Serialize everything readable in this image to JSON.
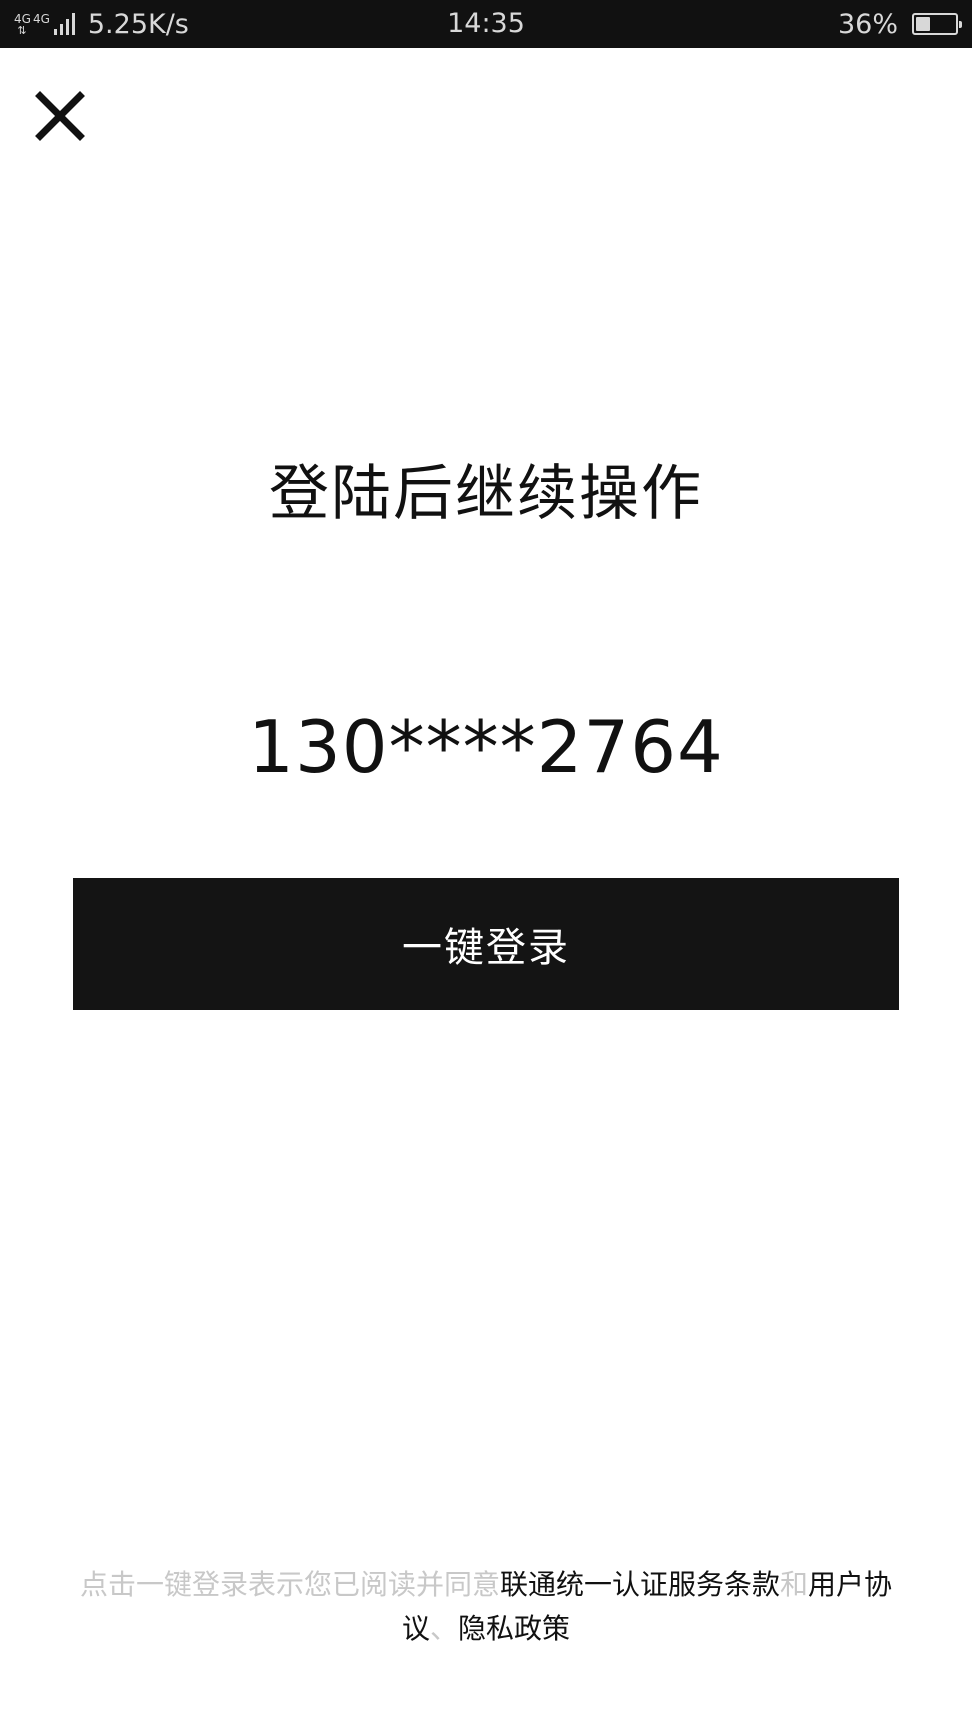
{
  "status_bar": {
    "network_type": "4G",
    "network_type_2": "4G",
    "net_speed": "5.25K/s",
    "time": "14:35",
    "battery_percent": "36%",
    "battery_level": 0.36
  },
  "close_icon": "close-icon",
  "title": "登陆后继续操作",
  "phone_number": "130****2764",
  "login_button_label": "一键登录",
  "agreement": {
    "prefix": "点击一键登录表示您已阅读并同意",
    "terms_link": "联通统一认证服务条款",
    "and": "和",
    "user_agreement_link": "用户协议",
    "separator": "、",
    "privacy_link": "隐私政策"
  }
}
